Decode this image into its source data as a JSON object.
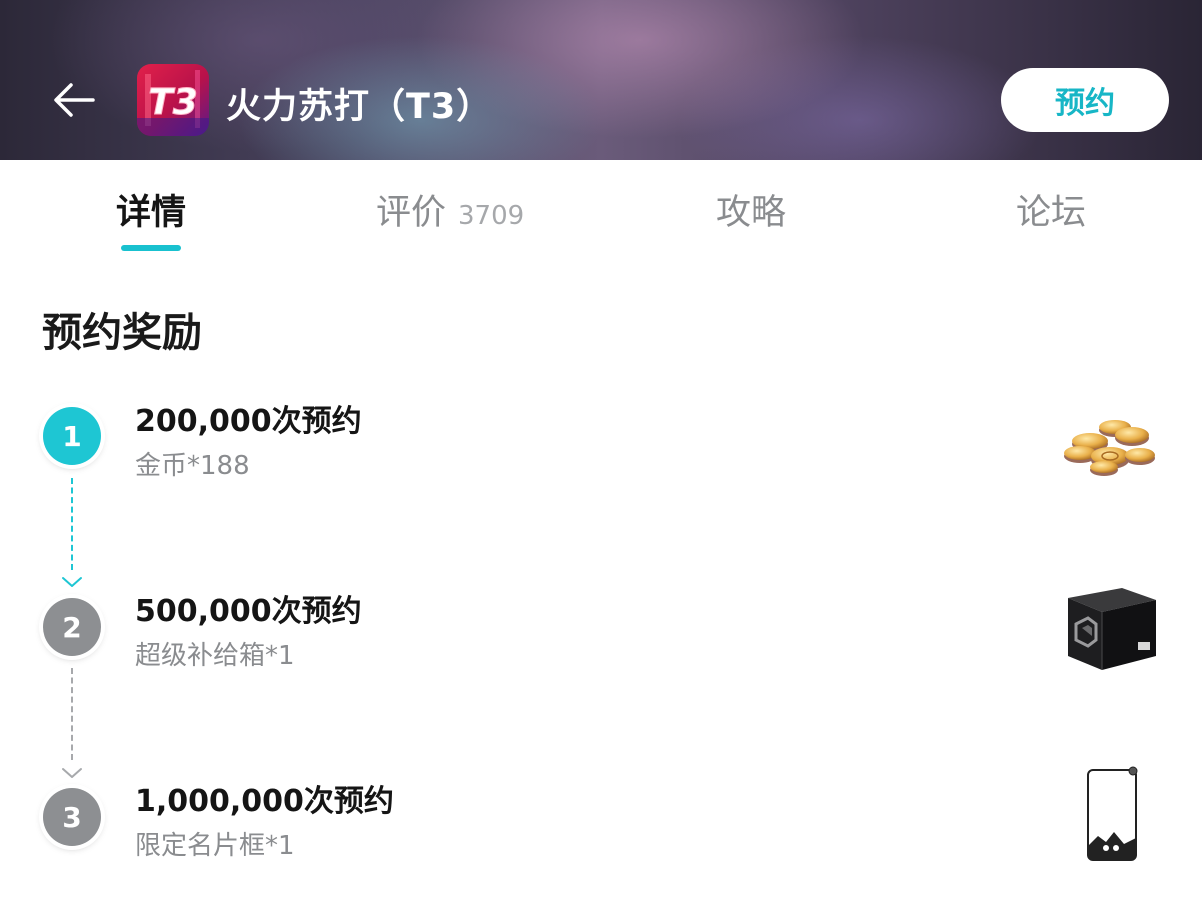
{
  "header": {
    "title": "火力苏打（T3）",
    "icon_text": "T3",
    "reserve_label": "预约",
    "accent_color": "#17b6c6"
  },
  "tabs": [
    {
      "label": "详情",
      "active": true
    },
    {
      "label": "评价",
      "count": "3709",
      "active": false
    },
    {
      "label": "攻略",
      "active": false
    },
    {
      "label": "论坛",
      "active": false
    }
  ],
  "section": {
    "title": "预约奖励",
    "milestones": [
      {
        "number": "1",
        "title": "200,000次预约",
        "reward": "金币*188",
        "reward_icon": "gold-coins",
        "reached": true
      },
      {
        "number": "2",
        "title": "500,000次预约",
        "reward": "超级补给箱*1",
        "reward_icon": "supply-box",
        "reached": false
      },
      {
        "number": "3",
        "title": "1,000,000次预约",
        "reward": "限定名片框*1",
        "reward_icon": "card-frame",
        "reached": false
      }
    ]
  }
}
